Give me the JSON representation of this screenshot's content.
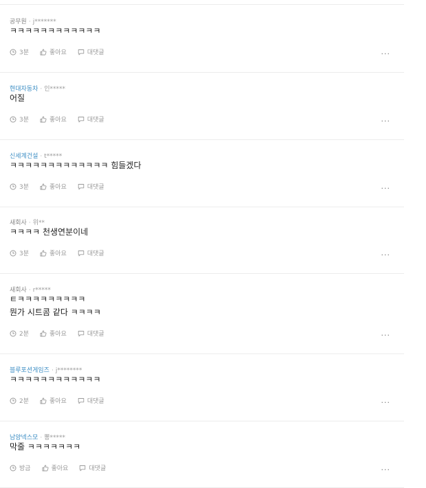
{
  "comments": [
    {
      "company": "공무원",
      "company_link": false,
      "user": "j*******",
      "lines": [
        "ㅋㅋㅋㅋㅋㅋㅋㅋㅋㅋㅋㅋ"
      ],
      "time": "3분",
      "like_label": "좋아요",
      "reply_label": "대댓글",
      "more": "..."
    },
    {
      "company": "현대자동차",
      "company_link": true,
      "user": "인*****",
      "lines": [
        "어질"
      ],
      "time": "3분",
      "like_label": "좋아요",
      "reply_label": "대댓글",
      "more": "..."
    },
    {
      "company": "신세계건설",
      "company_link": true,
      "user": "t*****",
      "lines": [
        "ㅋㅋㅋㅋㅋㅋㅋㅋㅋㅋㅋㅋㅋ 힘들겠다"
      ],
      "time": "3분",
      "like_label": "좋아요",
      "reply_label": "대댓글",
      "more": "..."
    },
    {
      "company": "새회사",
      "company_link": false,
      "user": "위**",
      "lines": [
        "ㅋㅋㅋㅋ 천생연분이네"
      ],
      "time": "3분",
      "like_label": "좋아요",
      "reply_label": "대댓글",
      "more": "..."
    },
    {
      "company": "새회사",
      "company_link": false,
      "user": "r*****",
      "lines": [
        "ㅌㅋㅋㅋㅋㅋㅋㅋㅋㅋ",
        "뭔가 시트콤 같다 ㅋㅋㅋㅋ"
      ],
      "time": "2분",
      "like_label": "좋아요",
      "reply_label": "대댓글",
      "more": "..."
    },
    {
      "company": "블루포션게임즈",
      "company_link": true,
      "user": "j********",
      "lines": [
        "ㅋㅋㅋㅋㅋㅋㅋㅋㅋㅋㅋㅋ"
      ],
      "time": "2분",
      "like_label": "좋아요",
      "reply_label": "대댓글",
      "more": "..."
    },
    {
      "company": "남양넥스모",
      "company_link": true,
      "user": "뽕*****",
      "lines": [
        "막줄 ㅋㅋㅋㅋㅋㅋㅋ"
      ],
      "time": "방금",
      "like_label": "좋아요",
      "reply_label": "대댓글",
      "more": "..."
    }
  ],
  "separator": "·"
}
